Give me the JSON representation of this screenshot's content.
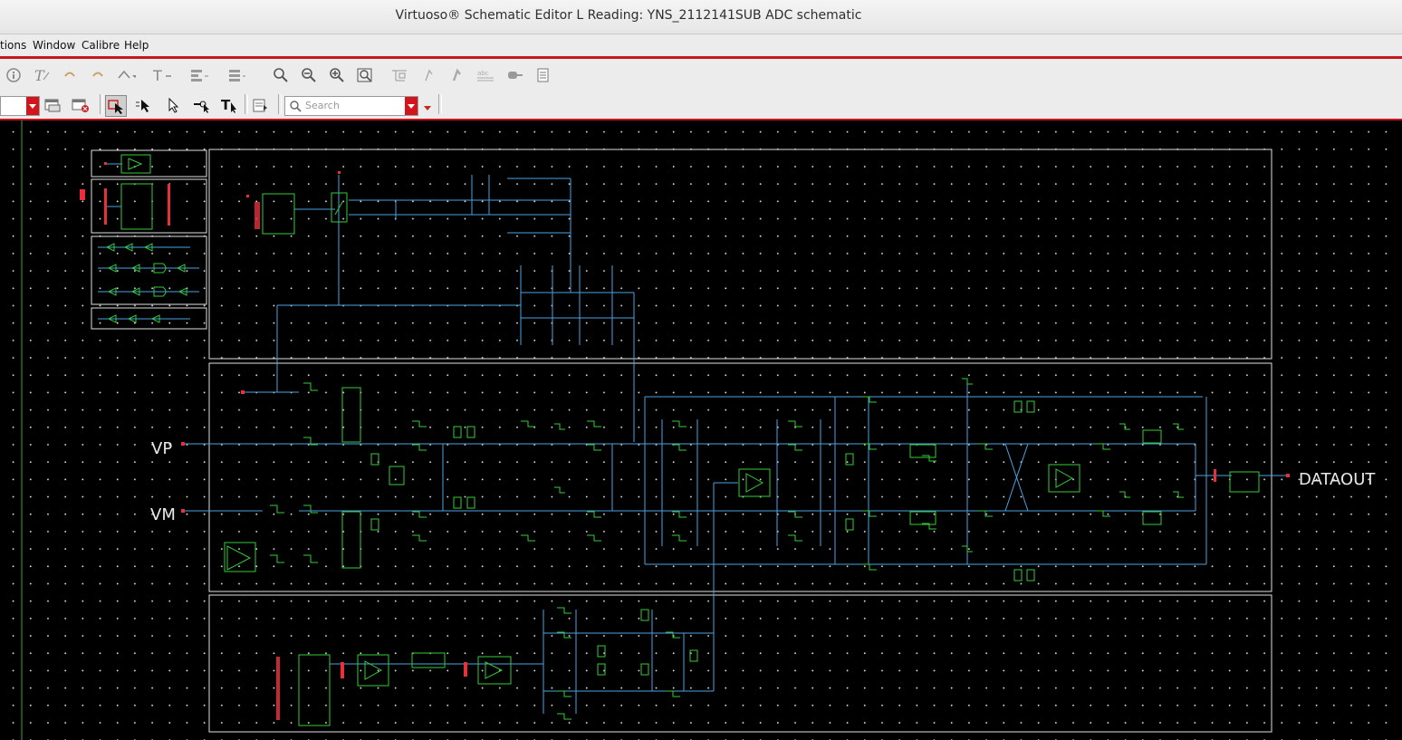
{
  "window": {
    "title": "Virtuoso® Schematic Editor L Reading: YNS_2112141SUB ADC schematic"
  },
  "menu": {
    "items": [
      {
        "label": "tions"
      },
      {
        "label": "Window"
      },
      {
        "label": "Calibre"
      },
      {
        "label": "Help"
      }
    ]
  },
  "toolbar": {
    "search_placeholder": "Search",
    "icons": [
      "info-icon",
      "text-icon",
      "undo-icon",
      "redo-icon",
      "stretch-icon",
      "label-icon",
      "align-icon",
      "distribute-icon",
      "zoom-fit-icon",
      "zoom-out-icon",
      "zoom-in-icon",
      "zoom-box-icon",
      "ruler-icon",
      "wire-icon",
      "bus-icon",
      "note-icon",
      "pin-icon",
      "instance-icon"
    ]
  },
  "schematic": {
    "pins": {
      "vp": "VP",
      "vm": "VM",
      "dataout": "DATAOUT"
    },
    "colors": {
      "background": "#000000",
      "wire": "#4aa3df",
      "instance": "#33cc33",
      "pin": "#e8303a",
      "frame": "#e8e8e8"
    }
  }
}
